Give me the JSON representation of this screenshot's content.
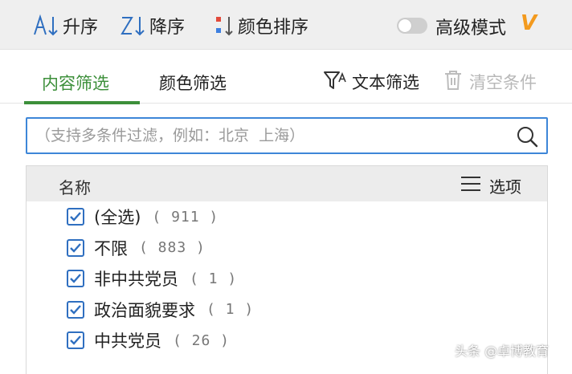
{
  "toolbar": {
    "sort_asc_label": "升序",
    "sort_desc_label": "降序",
    "color_sort_label": "颜色排序",
    "advanced_mode_label": "高级模式",
    "advanced_mode_on": false,
    "vip_badge": "V"
  },
  "tabs": {
    "content_filter": "内容筛选",
    "color_filter": "颜色筛选",
    "active": "content_filter"
  },
  "actions": {
    "text_filter": "文本筛选",
    "clear_conditions": "清空条件"
  },
  "search": {
    "placeholder": "（支持多条件过滤，例如：北京  上海）"
  },
  "list": {
    "column_name": "名称",
    "options_label": "选项",
    "items": [
      {
        "label": "(全选)",
        "count": "( 911 )",
        "checked": true
      },
      {
        "label": "不限",
        "count": "( 883 )",
        "checked": true
      },
      {
        "label": "非中共党员",
        "count": "( 1 )",
        "checked": true
      },
      {
        "label": "政治面貌要求",
        "count": "( 1 )",
        "checked": true
      },
      {
        "label": "中共党员",
        "count": "( 26 )",
        "checked": true
      }
    ]
  },
  "watermark": "头条 @卓博教育",
  "colors": {
    "accent_green": "#3c8f3a",
    "search_border": "#3d86d8",
    "checkbox_blue": "#2f6fc0",
    "vip_orange": "#f39a1e",
    "toolbar_bg": "#efefef"
  }
}
